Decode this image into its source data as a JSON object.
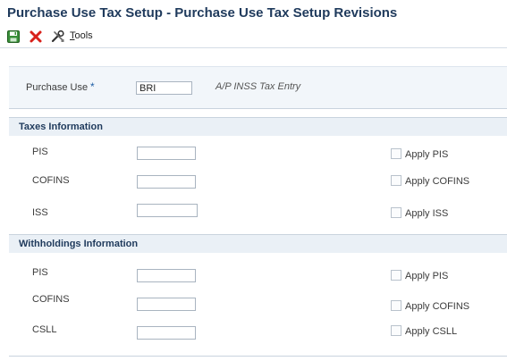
{
  "window": {
    "title": "Purchase Use Tax Setup - Purchase Use Tax Setup Revisions"
  },
  "toolbar": {
    "save_icon": "save-icon",
    "cancel_icon": "cancel-x-icon",
    "tools_icon": "tools-icon",
    "tools_label_hotkey": "T",
    "tools_label_rest": "ools"
  },
  "header": {
    "purchase_use_label": "Purchase Use",
    "required_marker": "*",
    "purchase_use_value": "BRI",
    "purchase_use_description": "A/P INSS Tax Entry"
  },
  "taxes": {
    "title": "Taxes Information",
    "rows": [
      {
        "label": "PIS",
        "value": "",
        "apply_label": "Apply PIS",
        "checked": false
      },
      {
        "label": "COFINS",
        "value": "",
        "apply_label": "Apply COFINS",
        "checked": false
      },
      {
        "label": "ISS",
        "value": "",
        "apply_label": "Apply ISS",
        "checked": false
      }
    ]
  },
  "withholdings": {
    "title": "Withholdings Information",
    "rows": [
      {
        "label": "PIS",
        "value": "",
        "apply_label": "Apply PIS",
        "checked": false
      },
      {
        "label": "COFINS",
        "value": "",
        "apply_label": "Apply COFINS",
        "checked": false
      },
      {
        "label": "CSLL",
        "value": "",
        "apply_label": "Apply CSLL",
        "checked": false
      }
    ]
  },
  "colors": {
    "title_color": "#1f3a5c",
    "section_header_bg": "#eaf0f6",
    "header_band_bg": "#f2f6fa",
    "required_color": "#1f5fa5"
  }
}
